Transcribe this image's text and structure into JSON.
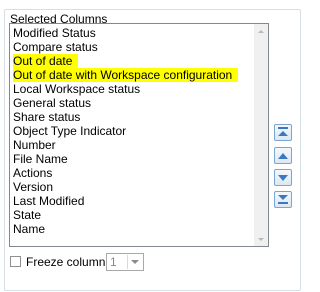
{
  "group_title": "Selected Columns",
  "columns": [
    {
      "label": "Modified Status",
      "highlighted": false
    },
    {
      "label": "Compare status",
      "highlighted": false
    },
    {
      "label": "Out of date",
      "highlighted": true
    },
    {
      "label": "Out of date with Workspace configuration",
      "highlighted": true
    },
    {
      "label": "Local Workspace status",
      "highlighted": false
    },
    {
      "label": "General status",
      "highlighted": false
    },
    {
      "label": "Share status",
      "highlighted": false
    },
    {
      "label": "Object Type Indicator",
      "highlighted": false
    },
    {
      "label": "Number",
      "highlighted": false
    },
    {
      "label": "File Name",
      "highlighted": false
    },
    {
      "label": "Actions",
      "highlighted": false
    },
    {
      "label": "Version",
      "highlighted": false
    },
    {
      "label": "Last Modified",
      "highlighted": false
    },
    {
      "label": "State",
      "highlighted": false
    },
    {
      "label": "Name",
      "highlighted": false
    }
  ],
  "move_buttons": [
    "move-to-top",
    "move-up",
    "move-down",
    "move-to-bottom"
  ],
  "freeze": {
    "label": "Freeze column",
    "checked": false,
    "value": "1"
  },
  "colors": {
    "highlight": "#ffff00",
    "button_border": "#7aa5d0",
    "arrow": "#3c78c0"
  }
}
